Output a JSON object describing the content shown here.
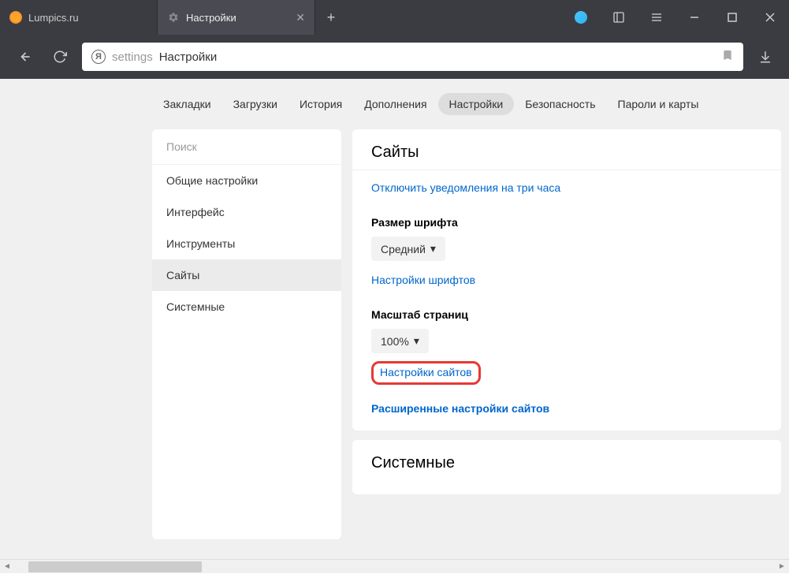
{
  "tabs": {
    "inactive_label": "Lumpics.ru",
    "active_label": "Настройки"
  },
  "address": {
    "prefix": "settings",
    "main": "Настройки"
  },
  "topnav": {
    "items": [
      "Закладки",
      "Загрузки",
      "История",
      "Дополнения",
      "Настройки",
      "Безопасность",
      "Пароли и карты"
    ]
  },
  "sidebar": {
    "search_placeholder": "Поиск",
    "items": [
      "Общие настройки",
      "Интерфейс",
      "Инструменты",
      "Сайты",
      "Системные"
    ]
  },
  "panel": {
    "title": "Сайты",
    "link_disable_notifications": "Отключить уведомления на три часа",
    "font_size_label": "Размер шрифта",
    "font_size_value": "Средний",
    "font_settings_link": "Настройки шрифтов",
    "scale_label": "Масштаб страниц",
    "scale_value": "100%",
    "site_settings_link": "Настройки сайтов",
    "advanced_link": "Расширенные настройки сайтов",
    "next_section": "Системные"
  }
}
